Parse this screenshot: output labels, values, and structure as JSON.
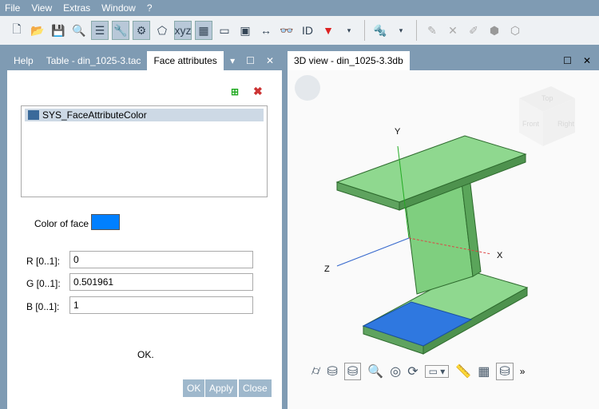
{
  "menu": [
    "File",
    "View",
    "Extras",
    "Window",
    "?"
  ],
  "left_panel": {
    "tabs": [
      "Help",
      "Table - din_1025-3.tac",
      "Face attributes"
    ],
    "list_item": "SYS_FaceAttributeColor",
    "color_label": "Color of face",
    "color": "#0080ff",
    "fields": [
      {
        "label": "R [0..1]:",
        "value": "0"
      },
      {
        "label": "G [0..1]:",
        "value": "0.501961"
      },
      {
        "label": "B [0..1]:",
        "value": "1"
      }
    ],
    "status": "OK.",
    "buttons": [
      "OK",
      "Apply",
      "Close"
    ]
  },
  "right_panel": {
    "title": "3D view - din_1025-3.3db",
    "axes": [
      "Y",
      "X",
      "Z"
    ],
    "cube": [
      "Top",
      "Front",
      "Right"
    ],
    "more": "»"
  }
}
